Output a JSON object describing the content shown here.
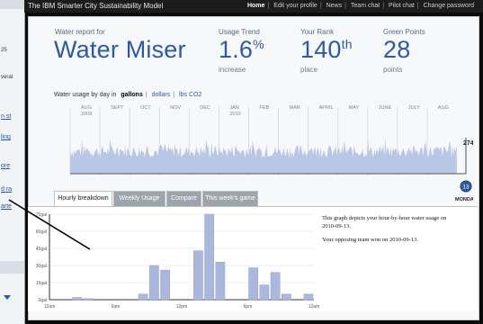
{
  "app": {
    "title": "The IBM Smarter City Sustainability Model",
    "nav": [
      "Home",
      "Edit your profile",
      "News",
      "Team chat",
      "Pilot chat",
      "Change password"
    ]
  },
  "left_strip": {
    "items": [
      "n st",
      "ling",
      "ore",
      "d ra",
      "arte"
    ],
    "labels": [
      "25",
      "verat"
    ]
  },
  "report": {
    "subtitle": "Water report for",
    "title": "Water Miser",
    "usage_trend": {
      "label": "Usage Trend",
      "value": "1.6",
      "suffix": "%",
      "unit": "increase"
    },
    "rank": {
      "label": "Your Rank",
      "value": "140",
      "suffix": "th",
      "unit": "place"
    },
    "green_points": {
      "label": "Green Points",
      "value": "28",
      "unit": "points"
    }
  },
  "usage_controls": {
    "label": "Water usage by day in",
    "units": [
      "gallons",
      "dollars",
      "lbs CO2"
    ],
    "selected": "gallons"
  },
  "timeline": {
    "months": [
      "AUG\n2009",
      "SEPT",
      "OCT",
      "NOV",
      "DEC",
      "JAN\n2010",
      "FEB",
      "MAR",
      "APRIL",
      "MAY",
      "JUNE",
      "JULY",
      "AUG"
    ],
    "current_value": "274gal",
    "slider_day": "13",
    "day_label": "MONDAY",
    "colors": {
      "area": "#b9c7e6",
      "slider": "#2e5fa8"
    }
  },
  "tabs": [
    "Hourly breakdown",
    "Weekly Usage",
    "Compare",
    "This week's game"
  ],
  "active_tab": "Hourly breakdown",
  "description": [
    "This graph depicts your hour-by-hour water usage on 2010-09-13.",
    "Your opposing team won on 2010-09-13."
  ],
  "chart_data": {
    "type": "bar",
    "title": "",
    "xlabel": "",
    "ylabel": "",
    "x_ticks": [
      "12am",
      "6am",
      "12pm",
      "6pm",
      "12am"
    ],
    "y_ticks": [
      "0gal",
      "15gal",
      "30gal",
      "45gal",
      "60gal",
      "75gal"
    ],
    "ylim": [
      0,
      75
    ],
    "categories": [
      "0",
      "1",
      "2",
      "3",
      "4",
      "5",
      "6",
      "7",
      "8",
      "9",
      "10",
      "11",
      "12",
      "13",
      "14",
      "15",
      "16",
      "17",
      "18",
      "19",
      "20",
      "21",
      "22",
      "23"
    ],
    "values": [
      0,
      0,
      2,
      1,
      0,
      0,
      0,
      0,
      5,
      30,
      26,
      0,
      0,
      43,
      75,
      33,
      0,
      0,
      28,
      13,
      24,
      5,
      0,
      5
    ],
    "bar_color": "#aab7de"
  },
  "annotation": {
    "color": "#000000"
  }
}
